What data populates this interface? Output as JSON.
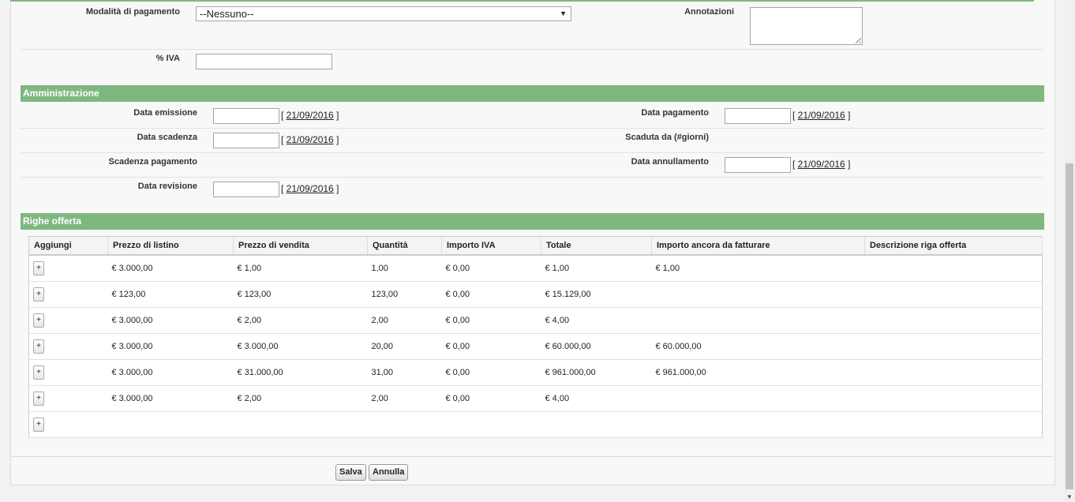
{
  "payment": {
    "method_label": "Modalità di pagamento",
    "method_value": "--Nessuno--",
    "notes_label": "Annotazioni",
    "vat_label": "% IVA"
  },
  "admin": {
    "title": "Amministrazione",
    "issue_label": "Data emissione",
    "issue_link": "21/09/2016",
    "due_label": "Data scadenza",
    "due_link": "21/09/2016",
    "payment_due_label": "Scadenza pagamento",
    "revision_label": "Data revisione",
    "revision_link": "21/09/2016",
    "payment_date_label": "Data pagamento",
    "payment_date_link": "21/09/2016",
    "overdue_label": "Scaduta da (#giorni)",
    "cancel_date_label": "Data annullamento",
    "cancel_date_link": "21/09/2016"
  },
  "lines": {
    "title": "Righe offerta",
    "columns": [
      "Aggiungi",
      "Prezzo di listino",
      "Prezzo di vendita",
      "Quantità",
      "Importo IVA",
      "Totale",
      "Importo ancora da fatturare",
      "Descrizione riga offerta"
    ],
    "add_symbol": "+",
    "rows": [
      {
        "list": "€ 3.000,00",
        "sale": "€ 1,00",
        "qty": "1,00",
        "vat": "€ 0,00",
        "total": "€ 1,00",
        "remaining": "€ 1,00",
        "desc": ""
      },
      {
        "list": "€ 123,00",
        "sale": "€ 123,00",
        "qty": "123,00",
        "vat": "€ 0,00",
        "total": "€ 15.129,00",
        "remaining": "",
        "desc": ""
      },
      {
        "list": "€ 3.000,00",
        "sale": "€ 2,00",
        "qty": "2,00",
        "vat": "€ 0,00",
        "total": "€ 4,00",
        "remaining": "",
        "desc": ""
      },
      {
        "list": "€ 3.000,00",
        "sale": "€ 3.000,00",
        "qty": "20,00",
        "vat": "€ 0,00",
        "total": "€ 60.000,00",
        "remaining": "€ 60.000,00",
        "desc": ""
      },
      {
        "list": "€ 3.000,00",
        "sale": "€ 31.000,00",
        "qty": "31,00",
        "vat": "€ 0,00",
        "total": "€ 961.000,00",
        "remaining": "€ 961.000,00",
        "desc": ""
      },
      {
        "list": "€ 3.000,00",
        "sale": "€ 2,00",
        "qty": "2,00",
        "vat": "€ 0,00",
        "total": "€ 4,00",
        "remaining": "",
        "desc": ""
      }
    ]
  },
  "buttons": {
    "save": "Salva",
    "cancel": "Annulla"
  },
  "colors": {
    "section": "#7fb87f"
  }
}
